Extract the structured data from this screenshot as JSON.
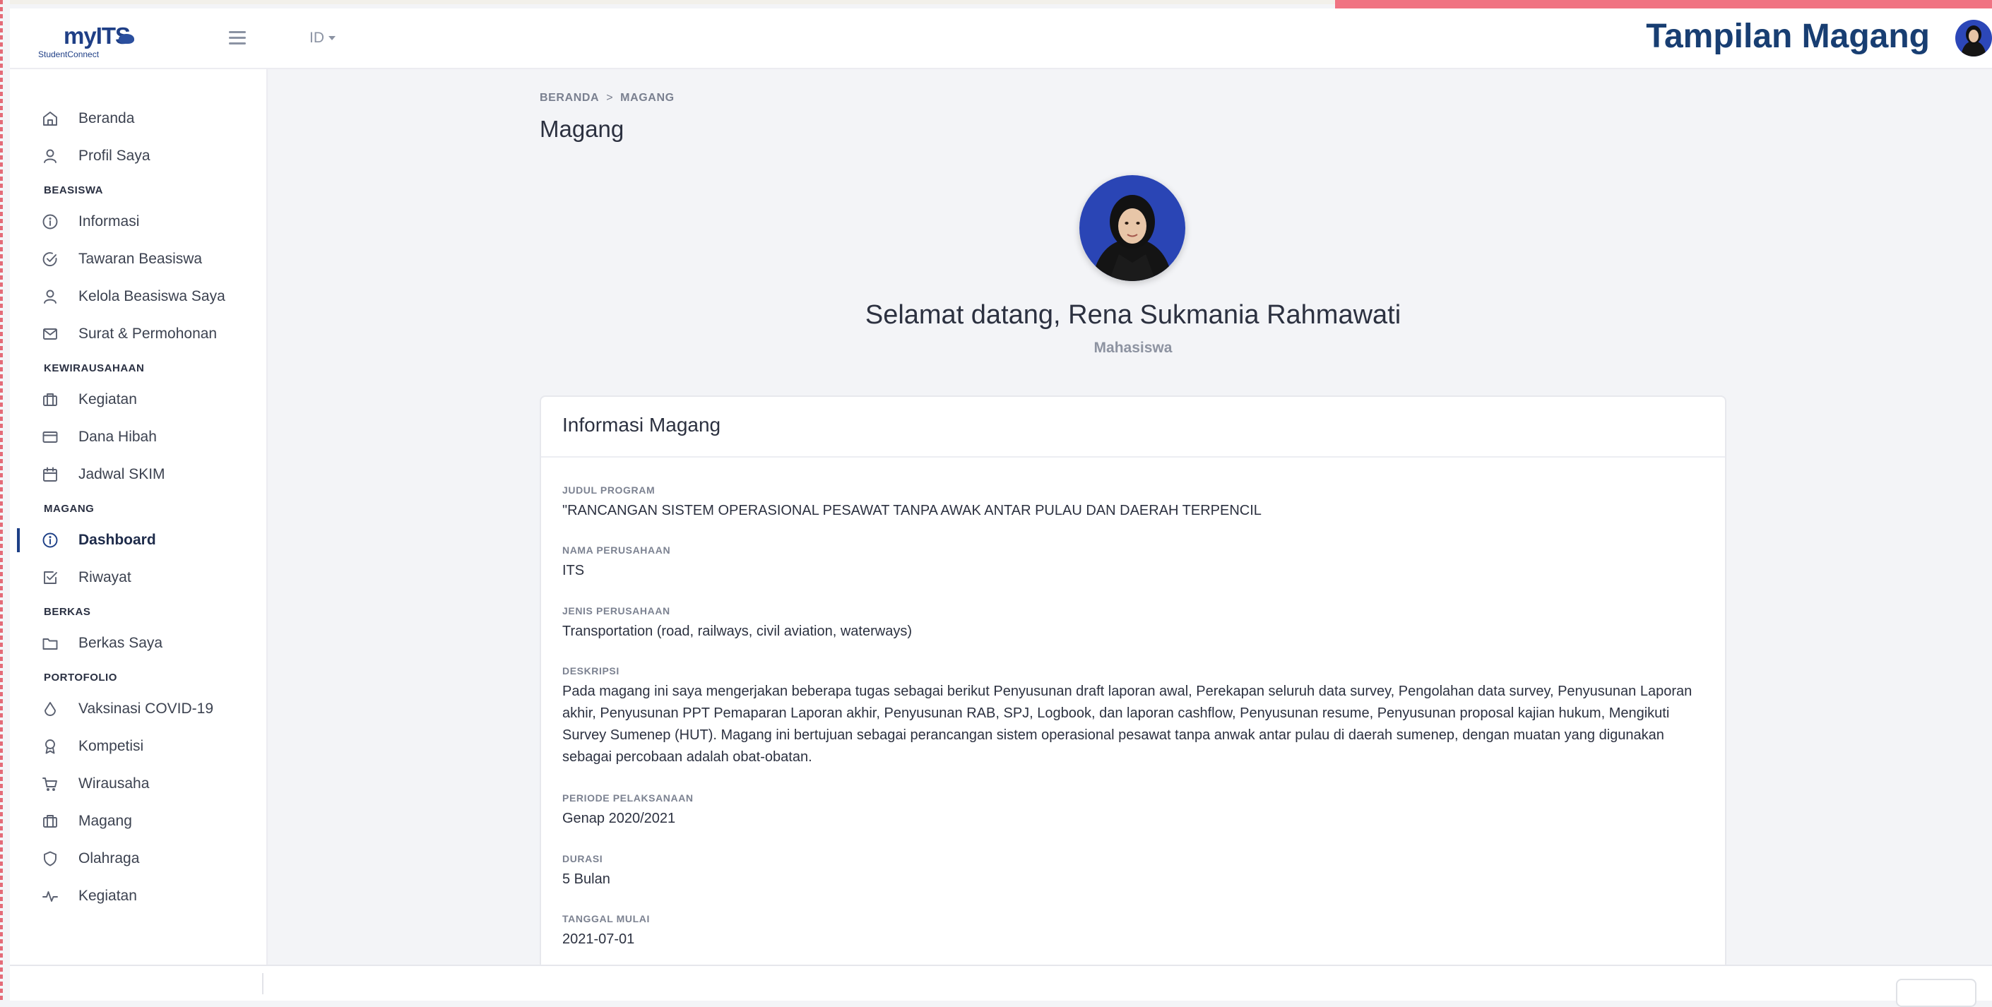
{
  "brand": {
    "logo_main": "myITS",
    "logo_sub": "StudentConnect"
  },
  "header": {
    "language": "ID",
    "slide_title": "Tampilan Magang"
  },
  "sidebar": {
    "items": [
      {
        "label": "Beranda",
        "icon": "home-icon"
      },
      {
        "label": "Profil Saya",
        "icon": "user-icon"
      }
    ],
    "sections": [
      {
        "title": "BEASISWA",
        "items": [
          {
            "label": "Informasi",
            "icon": "info-icon"
          },
          {
            "label": "Tawaran Beasiswa",
            "icon": "check-circle-icon"
          },
          {
            "label": "Kelola Beasiswa Saya",
            "icon": "user-icon"
          },
          {
            "label": "Surat & Permohonan",
            "icon": "mail-icon"
          }
        ]
      },
      {
        "title": "KEWIRAUSAHAAN",
        "items": [
          {
            "label": "Kegiatan",
            "icon": "briefcase-icon"
          },
          {
            "label": "Dana Hibah",
            "icon": "credit-card-icon"
          },
          {
            "label": "Jadwal SKIM",
            "icon": "calendar-icon"
          }
        ]
      },
      {
        "title": "MAGANG",
        "items": [
          {
            "label": "Dashboard",
            "icon": "info-icon",
            "active": true
          },
          {
            "label": "Riwayat",
            "icon": "check-square-icon"
          }
        ]
      },
      {
        "title": "BERKAS",
        "items": [
          {
            "label": "Berkas Saya",
            "icon": "folder-icon"
          }
        ]
      },
      {
        "title": "PORTOFOLIO",
        "items": [
          {
            "label": "Vaksinasi COVID-19",
            "icon": "droplet-icon"
          },
          {
            "label": "Kompetisi",
            "icon": "award-icon"
          },
          {
            "label": "Wirausaha",
            "icon": "cart-icon"
          },
          {
            "label": "Magang",
            "icon": "briefcase-icon"
          },
          {
            "label": "Olahraga",
            "icon": "shield-icon"
          },
          {
            "label": "Kegiatan",
            "icon": "activity-icon"
          }
        ]
      }
    ]
  },
  "breadcrumb": {
    "home": "BERANDA",
    "separator": ">",
    "current": "MAGANG"
  },
  "page": {
    "title": "Magang",
    "welcome": "Selamat datang, Rena Sukmania Rahmawati",
    "role": "Mahasiswa"
  },
  "card": {
    "title": "Informasi Magang",
    "fields": [
      {
        "label": "JUDUL PROGRAM",
        "value": "\"RANCANGAN SISTEM OPERASIONAL PESAWAT TANPA AWAK ANTAR PULAU DAN DAERAH TERPENCIL"
      },
      {
        "label": "NAMA PERUSAHAAN",
        "value": "ITS"
      },
      {
        "label": "JENIS PERUSAHAAN",
        "value": "Transportation (road, railways, civil aviation, waterways)"
      },
      {
        "label": "DESKRIPSI",
        "value": "Pada magang ini saya mengerjakan beberapa tugas sebagai berikut Penyusunan draft laporan awal, Perekapan seluruh data survey, Pengolahan data survey, Penyusunan Laporan akhir, Penyusunan PPT Pemaparan Laporan akhir, Penyusunan RAB, SPJ, Logbook, dan laporan cashflow, Penyusunan resume, Penyusunan proposal kajian hukum, Mengikuti Survey Sumenep (HUT). Magang ini bertujuan sebagai perancangan sistem operasional pesawat tanpa anwak antar pulau di daerah sumenep, dengan muatan yang digunakan sebagai percobaan adalah obat-obatan."
      },
      {
        "label": "PERIODE PELAKSANAAN",
        "value": "Genap 2020/2021"
      },
      {
        "label": "DURASI",
        "value": "5 Bulan"
      },
      {
        "label": "TANGGAL MULAI",
        "value": "2021-07-01"
      }
    ]
  },
  "colors": {
    "primary": "#1f3f86",
    "accent_pink": "#f07382",
    "slide_title": "#183e72"
  }
}
